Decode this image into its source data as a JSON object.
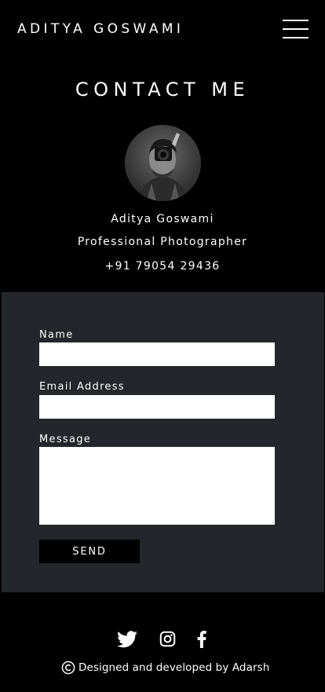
{
  "header": {
    "brand": "ADITYA GOSWAMI",
    "menu_icon": "hamburger-menu-icon"
  },
  "contact": {
    "title": "CONTACT ME",
    "avatar_icon": "profile-photo",
    "name": "Aditya Goswami",
    "role": "Professional Photographer",
    "phone": "+91 79054 29436"
  },
  "form": {
    "name_label": "Name",
    "name_value": "",
    "email_label": "Email Address",
    "email_value": "",
    "message_label": "Message",
    "message_value": "",
    "send_label": "SEND"
  },
  "footer": {
    "social": [
      "twitter-icon",
      "instagram-icon",
      "facebook-icon"
    ],
    "copyright_icon": "copyright-icon",
    "credit": "Designed and developed by Adarsh"
  },
  "colors": {
    "background": "#000000",
    "panel": "#23272b",
    "text": "#ffffff",
    "input": "#ffffff"
  }
}
